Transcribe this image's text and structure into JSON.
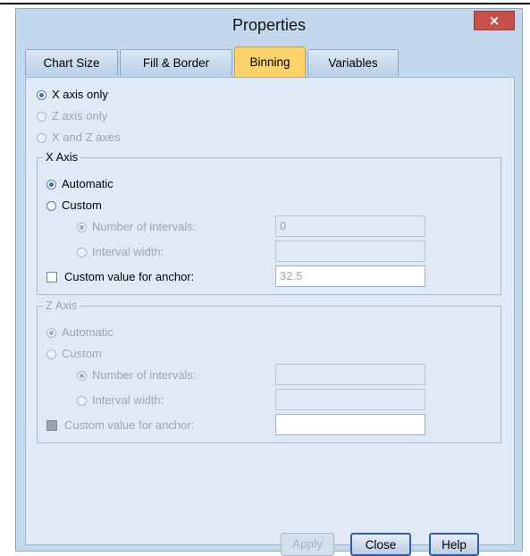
{
  "window": {
    "title": "Properties",
    "close_symbol": "×"
  },
  "tabs": [
    {
      "label": "Chart Size",
      "active": false
    },
    {
      "label": "Fill & Border",
      "active": false
    },
    {
      "label": "Binning",
      "active": true
    },
    {
      "label": "Variables",
      "active": false
    }
  ],
  "axis_choice": {
    "x_only": "X axis only",
    "z_only": "Z axis only",
    "x_and_z": "X and Z axes"
  },
  "x_axis": {
    "label": "X Axis",
    "automatic": "Automatic",
    "custom": "Custom",
    "num_intervals_label": "Number of intervals:",
    "num_intervals_value": "0",
    "interval_width_label": "Interval width:",
    "interval_width_value": "",
    "anchor_label": "Custom value for anchor:",
    "anchor_value": "32.5"
  },
  "z_axis": {
    "label": "Z Axis",
    "automatic": "Automatic",
    "custom": "Custom",
    "num_intervals_label": "Number of intervals:",
    "num_intervals_value": "",
    "interval_width_label": "Interval width:",
    "interval_width_value": "",
    "anchor_label": "Custom value for anchor:",
    "anchor_value": ""
  },
  "buttons": {
    "apply": "Apply",
    "close": "Close",
    "help": "Help"
  }
}
